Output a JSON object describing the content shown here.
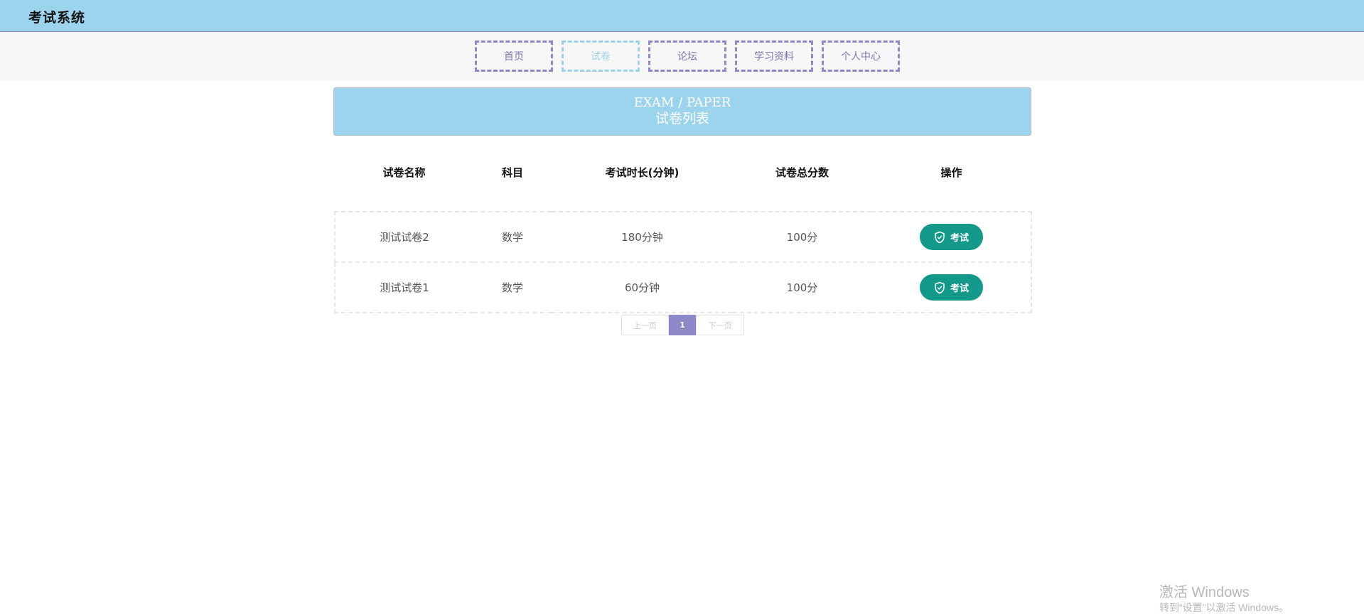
{
  "header": {
    "title": "考试系统"
  },
  "nav": {
    "items": [
      {
        "label": "首页"
      },
      {
        "label": "试卷"
      },
      {
        "label": "论坛"
      },
      {
        "label": "学习资料"
      },
      {
        "label": "个人中心"
      }
    ],
    "active_index": 1
  },
  "banner": {
    "en": "EXAM / PAPER",
    "cn": "试卷列表"
  },
  "table": {
    "headers": [
      "试卷名称",
      "科目",
      "考试时长(分钟)",
      "试卷总分数",
      "操作"
    ],
    "rows": [
      {
        "name": "测试试卷2",
        "subject": "数学",
        "duration": "180分钟",
        "score": "100分",
        "action": "考试"
      },
      {
        "name": "测试试卷1",
        "subject": "数学",
        "duration": "60分钟",
        "score": "100分",
        "action": "考试"
      }
    ]
  },
  "pagination": {
    "prev": "上一页",
    "current": "1",
    "next": "下一页"
  },
  "watermark": {
    "title": "激活 Windows",
    "subtitle": "转到“设置”以激活 Windows。"
  },
  "colors": {
    "header_bg": "#9cd4ee",
    "nav_border": "#8d88c8",
    "nav_active": "#9cd4ee",
    "exam_button": "#13998a",
    "pager_active": "#8d88c8"
  },
  "icons": {
    "exam_button_icon": "shield-check-icon"
  }
}
